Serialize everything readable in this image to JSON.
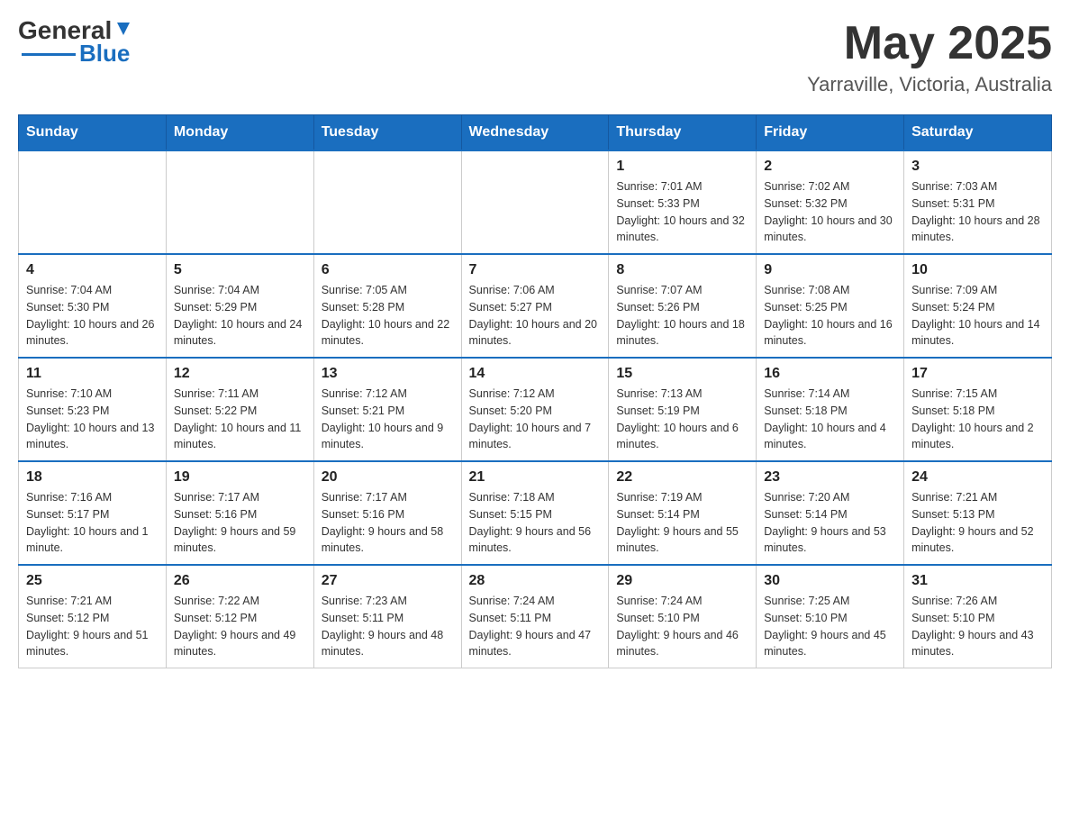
{
  "header": {
    "logo_text_general": "General",
    "logo_text_blue": "Blue",
    "month_title": "May 2025",
    "location": "Yarraville, Victoria, Australia"
  },
  "days_of_week": [
    "Sunday",
    "Monday",
    "Tuesday",
    "Wednesday",
    "Thursday",
    "Friday",
    "Saturday"
  ],
  "weeks": [
    {
      "days": [
        {
          "number": "",
          "info": ""
        },
        {
          "number": "",
          "info": ""
        },
        {
          "number": "",
          "info": ""
        },
        {
          "number": "",
          "info": ""
        },
        {
          "number": "1",
          "info": "Sunrise: 7:01 AM\nSunset: 5:33 PM\nDaylight: 10 hours and 32 minutes."
        },
        {
          "number": "2",
          "info": "Sunrise: 7:02 AM\nSunset: 5:32 PM\nDaylight: 10 hours and 30 minutes."
        },
        {
          "number": "3",
          "info": "Sunrise: 7:03 AM\nSunset: 5:31 PM\nDaylight: 10 hours and 28 minutes."
        }
      ]
    },
    {
      "days": [
        {
          "number": "4",
          "info": "Sunrise: 7:04 AM\nSunset: 5:30 PM\nDaylight: 10 hours and 26 minutes."
        },
        {
          "number": "5",
          "info": "Sunrise: 7:04 AM\nSunset: 5:29 PM\nDaylight: 10 hours and 24 minutes."
        },
        {
          "number": "6",
          "info": "Sunrise: 7:05 AM\nSunset: 5:28 PM\nDaylight: 10 hours and 22 minutes."
        },
        {
          "number": "7",
          "info": "Sunrise: 7:06 AM\nSunset: 5:27 PM\nDaylight: 10 hours and 20 minutes."
        },
        {
          "number": "8",
          "info": "Sunrise: 7:07 AM\nSunset: 5:26 PM\nDaylight: 10 hours and 18 minutes."
        },
        {
          "number": "9",
          "info": "Sunrise: 7:08 AM\nSunset: 5:25 PM\nDaylight: 10 hours and 16 minutes."
        },
        {
          "number": "10",
          "info": "Sunrise: 7:09 AM\nSunset: 5:24 PM\nDaylight: 10 hours and 14 minutes."
        }
      ]
    },
    {
      "days": [
        {
          "number": "11",
          "info": "Sunrise: 7:10 AM\nSunset: 5:23 PM\nDaylight: 10 hours and 13 minutes."
        },
        {
          "number": "12",
          "info": "Sunrise: 7:11 AM\nSunset: 5:22 PM\nDaylight: 10 hours and 11 minutes."
        },
        {
          "number": "13",
          "info": "Sunrise: 7:12 AM\nSunset: 5:21 PM\nDaylight: 10 hours and 9 minutes."
        },
        {
          "number": "14",
          "info": "Sunrise: 7:12 AM\nSunset: 5:20 PM\nDaylight: 10 hours and 7 minutes."
        },
        {
          "number": "15",
          "info": "Sunrise: 7:13 AM\nSunset: 5:19 PM\nDaylight: 10 hours and 6 minutes."
        },
        {
          "number": "16",
          "info": "Sunrise: 7:14 AM\nSunset: 5:18 PM\nDaylight: 10 hours and 4 minutes."
        },
        {
          "number": "17",
          "info": "Sunrise: 7:15 AM\nSunset: 5:18 PM\nDaylight: 10 hours and 2 minutes."
        }
      ]
    },
    {
      "days": [
        {
          "number": "18",
          "info": "Sunrise: 7:16 AM\nSunset: 5:17 PM\nDaylight: 10 hours and 1 minute."
        },
        {
          "number": "19",
          "info": "Sunrise: 7:17 AM\nSunset: 5:16 PM\nDaylight: 9 hours and 59 minutes."
        },
        {
          "number": "20",
          "info": "Sunrise: 7:17 AM\nSunset: 5:16 PM\nDaylight: 9 hours and 58 minutes."
        },
        {
          "number": "21",
          "info": "Sunrise: 7:18 AM\nSunset: 5:15 PM\nDaylight: 9 hours and 56 minutes."
        },
        {
          "number": "22",
          "info": "Sunrise: 7:19 AM\nSunset: 5:14 PM\nDaylight: 9 hours and 55 minutes."
        },
        {
          "number": "23",
          "info": "Sunrise: 7:20 AM\nSunset: 5:14 PM\nDaylight: 9 hours and 53 minutes."
        },
        {
          "number": "24",
          "info": "Sunrise: 7:21 AM\nSunset: 5:13 PM\nDaylight: 9 hours and 52 minutes."
        }
      ]
    },
    {
      "days": [
        {
          "number": "25",
          "info": "Sunrise: 7:21 AM\nSunset: 5:12 PM\nDaylight: 9 hours and 51 minutes."
        },
        {
          "number": "26",
          "info": "Sunrise: 7:22 AM\nSunset: 5:12 PM\nDaylight: 9 hours and 49 minutes."
        },
        {
          "number": "27",
          "info": "Sunrise: 7:23 AM\nSunset: 5:11 PM\nDaylight: 9 hours and 48 minutes."
        },
        {
          "number": "28",
          "info": "Sunrise: 7:24 AM\nSunset: 5:11 PM\nDaylight: 9 hours and 47 minutes."
        },
        {
          "number": "29",
          "info": "Sunrise: 7:24 AM\nSunset: 5:10 PM\nDaylight: 9 hours and 46 minutes."
        },
        {
          "number": "30",
          "info": "Sunrise: 7:25 AM\nSunset: 5:10 PM\nDaylight: 9 hours and 45 minutes."
        },
        {
          "number": "31",
          "info": "Sunrise: 7:26 AM\nSunset: 5:10 PM\nDaylight: 9 hours and 43 minutes."
        }
      ]
    }
  ]
}
